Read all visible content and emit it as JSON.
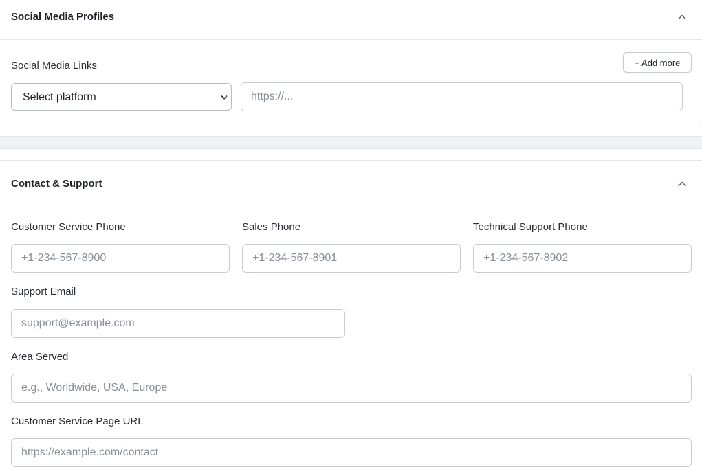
{
  "social": {
    "title": "Social Media Profiles",
    "links_label": "Social Media Links",
    "add_more_label": "+ Add more",
    "platform_select": "Select platform",
    "url_placeholder": "https://..."
  },
  "contact": {
    "title": "Contact & Support",
    "customer_phone_label": "Customer Service Phone",
    "customer_phone_placeholder": "+1-234-567-8900",
    "sales_phone_label": "Sales Phone",
    "sales_phone_placeholder": "+1-234-567-8901",
    "tech_phone_label": "Technical Support Phone",
    "tech_phone_placeholder": "+1-234-567-8902",
    "support_email_label": "Support Email",
    "support_email_placeholder": "support@example.com",
    "area_served_label": "Area Served",
    "area_served_placeholder": "e.g., Worldwide, USA, Europe",
    "cs_url_label": "Customer Service Page URL",
    "cs_url_placeholder": "https://example.com/contact"
  },
  "icons": {
    "collapse": "chevron-up-icon",
    "dropdown": "chevron-down-icon"
  }
}
